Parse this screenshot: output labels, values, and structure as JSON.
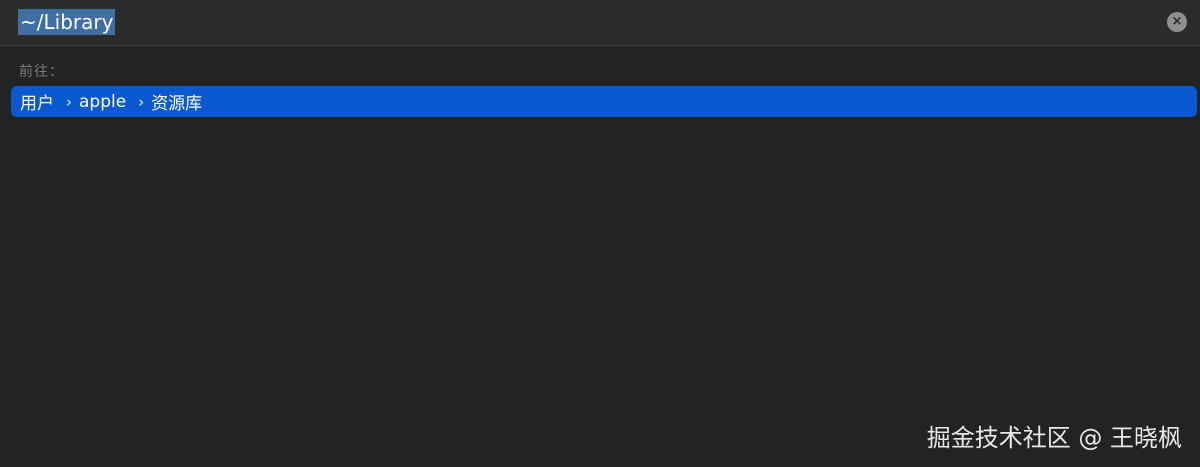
{
  "search": {
    "value": "~/Library"
  },
  "clear_icon": "×",
  "section_label": "前往：",
  "result": {
    "crumbs": [
      "用户",
      "apple",
      "资源库"
    ],
    "separator": "›"
  },
  "watermark": "掘金技术社区 @ 王晓枫",
  "colors": {
    "background": "#232323",
    "selection": "#0a59d0",
    "text_highlight": "#3f6ea3"
  }
}
